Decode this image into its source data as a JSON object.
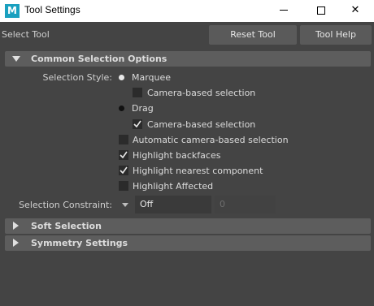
{
  "window": {
    "title": "Tool Settings",
    "logo_letter": "M",
    "minimize_label": "—",
    "maximize_label": "",
    "close_label": "✕"
  },
  "header": {
    "tool_name": "Select Tool",
    "reset_label": "Reset Tool",
    "help_label": "Tool Help"
  },
  "sections": {
    "common": {
      "title": "Common Selection Options",
      "expanded": true
    },
    "soft": {
      "title": "Soft Selection",
      "expanded": false
    },
    "symmetry": {
      "title": "Symmetry Settings",
      "expanded": false
    }
  },
  "common": {
    "selection_style_label": "Selection Style:",
    "marquee_label": "Marquee",
    "marquee_selected": true,
    "marquee_camera_label": "Camera-based selection",
    "marquee_camera_checked": false,
    "drag_label": "Drag",
    "drag_selected": false,
    "drag_camera_label": "Camera-based selection",
    "drag_camera_checked": true,
    "auto_camera_label": "Automatic camera-based selection",
    "auto_camera_checked": false,
    "highlight_backfaces_label": "Highlight backfaces",
    "highlight_backfaces_checked": true,
    "highlight_nearest_label": "Highlight nearest component",
    "highlight_nearest_checked": true,
    "highlight_affected_label": "Highlight Affected",
    "highlight_affected_checked": false,
    "constraint_label": "Selection Constraint:",
    "constraint_value": "Off",
    "constraint_number": "0"
  },
  "colors": {
    "background": "#444444",
    "section_header": "#5d5d5d",
    "button": "#5a5a5a",
    "field": "#3a3a3a",
    "checkbox": "#2b2b2b",
    "logo": "#1aa0bf"
  }
}
